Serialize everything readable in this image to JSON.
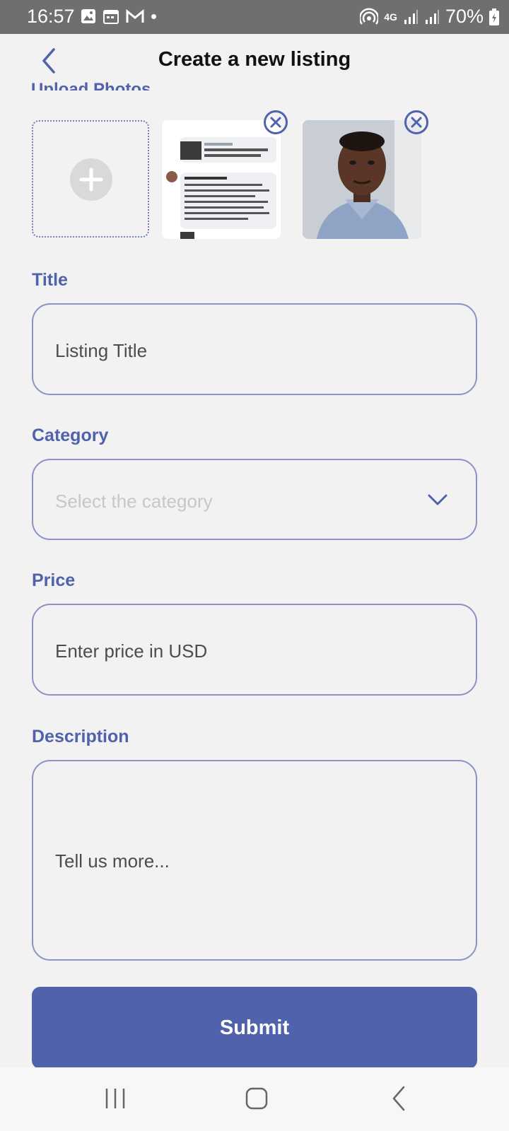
{
  "status_bar": {
    "time": "16:57",
    "battery": "70%",
    "network": "4G",
    "icons": [
      "image-icon",
      "calendar-icon",
      "gmail-icon",
      "dot-icon",
      "hotspot-icon",
      "signal-icon",
      "signal-icon",
      "battery-icon"
    ]
  },
  "header": {
    "title": "Create a new listing",
    "back_icon": "chevron-left-icon"
  },
  "photos": {
    "section_label_partial": "Upload Photos",
    "add_icon": "plus-icon",
    "remove_icon": "close-circle-icon"
  },
  "form": {
    "title_label": "Title",
    "title_placeholder": "Listing Title",
    "category_label": "Category",
    "category_placeholder": "Select the category",
    "price_label": "Price",
    "price_placeholder": "Enter price in USD",
    "description_label": "Description",
    "description_placeholder": "Tell us more..."
  },
  "submit_label": "Submit",
  "colors": {
    "accent": "#4f62ab",
    "background": "#f2f2f2",
    "status_bar": "#6f6f6f"
  }
}
